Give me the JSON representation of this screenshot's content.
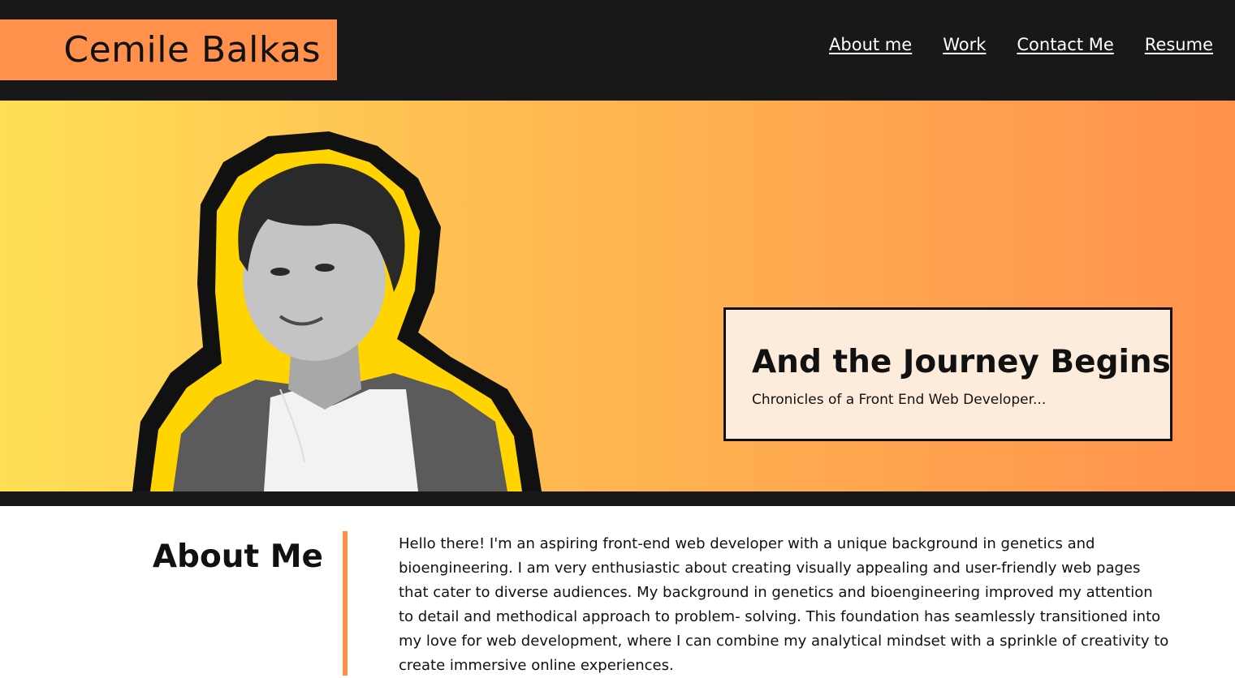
{
  "header": {
    "logo_text": "Cemile Balkas",
    "nav": [
      {
        "label": "About me"
      },
      {
        "label": "Work"
      },
      {
        "label": "Contact Me"
      },
      {
        "label": "Resume"
      }
    ]
  },
  "hero": {
    "title": "And the Journey Begins",
    "subtitle": "Chronicles of a Front End Web Developer..."
  },
  "about": {
    "heading": "About Me",
    "text": "Hello there! I'm an aspiring front-end web developer with a unique background in genetics and bioengineering. I am very enthusiastic about creating visually appealing and user-friendly web pages that cater to diverse audiences. My background in genetics and bioengineering improved my attention to detail and methodical approach to problem- solving. This foundation has seamlessly transitioned into my love for web development, where I can combine my analytical mindset with a sprinkle of creativity to create immersive online experiences."
  },
  "colors": {
    "header_bg": "#181818",
    "accent_orange": "#ff914d",
    "gradient_start": "#ffdf56",
    "gradient_end": "#ff914d",
    "card_bg": "#fdebdc",
    "portrait_outline": "#ffd400"
  },
  "icons": {
    "portrait": "portrait-photo"
  }
}
